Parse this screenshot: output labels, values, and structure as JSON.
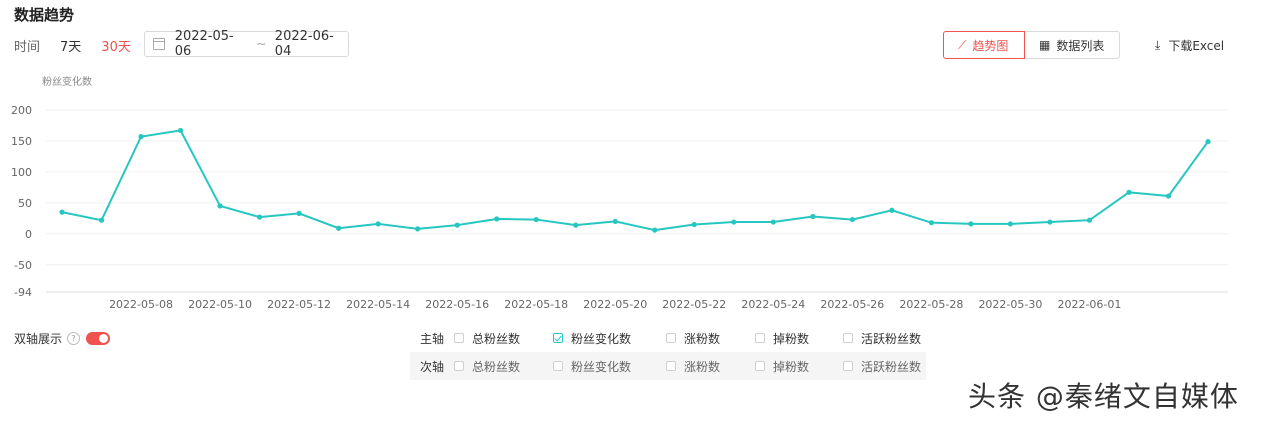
{
  "header": {
    "title": "数据趋势"
  },
  "filters": {
    "label": "时间",
    "options": [
      {
        "label": "7天",
        "active": false
      },
      {
        "label": "30天",
        "active": true
      }
    ],
    "date_from": "2022-05-06",
    "date_sep": "~",
    "date_to": "2022-06-04"
  },
  "view_toggle": {
    "trend_label": "趋势图",
    "list_label": "数据列表",
    "active": "trend"
  },
  "download_label": "下载Excel",
  "chart_data": {
    "type": "line",
    "ylabel": "粉丝变化数",
    "ylim": [
      -94,
      200
    ],
    "yticks": [
      200,
      150,
      100,
      50,
      0,
      -50,
      -94
    ],
    "grid": true,
    "color": "#26c6c1",
    "x": [
      "2022-05-06",
      "2022-05-07",
      "2022-05-08",
      "2022-05-09",
      "2022-05-10",
      "2022-05-11",
      "2022-05-12",
      "2022-05-13",
      "2022-05-14",
      "2022-05-15",
      "2022-05-16",
      "2022-05-17",
      "2022-05-18",
      "2022-05-19",
      "2022-05-20",
      "2022-05-21",
      "2022-05-22",
      "2022-05-23",
      "2022-05-24",
      "2022-05-25",
      "2022-05-26",
      "2022-05-27",
      "2022-05-28",
      "2022-05-29",
      "2022-05-30",
      "2022-05-31",
      "2022-06-01",
      "2022-06-02",
      "2022-06-03",
      "2022-06-04"
    ],
    "values": [
      35,
      22,
      157,
      167,
      45,
      27,
      33,
      9,
      16,
      8,
      14,
      24,
      23,
      14,
      20,
      6,
      15,
      19,
      19,
      28,
      23,
      38,
      18,
      16,
      16,
      19,
      22,
      67,
      61,
      149
    ],
    "xtick_labels": [
      "2022-05-08",
      "2022-05-10",
      "2022-05-12",
      "2022-05-14",
      "2022-05-16",
      "2022-05-18",
      "2022-05-20",
      "2022-05-22",
      "2022-05-24",
      "2022-05-26",
      "2022-05-28",
      "2022-05-30",
      "2022-06-01"
    ]
  },
  "dual_axis": {
    "label": "双轴展示",
    "help": "?",
    "enabled": true
  },
  "axes": {
    "primary_label": "主轴",
    "secondary_label": "次轴",
    "metrics": [
      "总粉丝数",
      "粉丝变化数",
      "涨粉数",
      "掉粉数",
      "活跃粉丝数"
    ],
    "primary_checked": [
      false,
      true,
      false,
      false,
      false
    ],
    "secondary_checked": [
      false,
      false,
      false,
      false,
      false
    ]
  },
  "watermark": "头条 @秦绪文自媒体"
}
